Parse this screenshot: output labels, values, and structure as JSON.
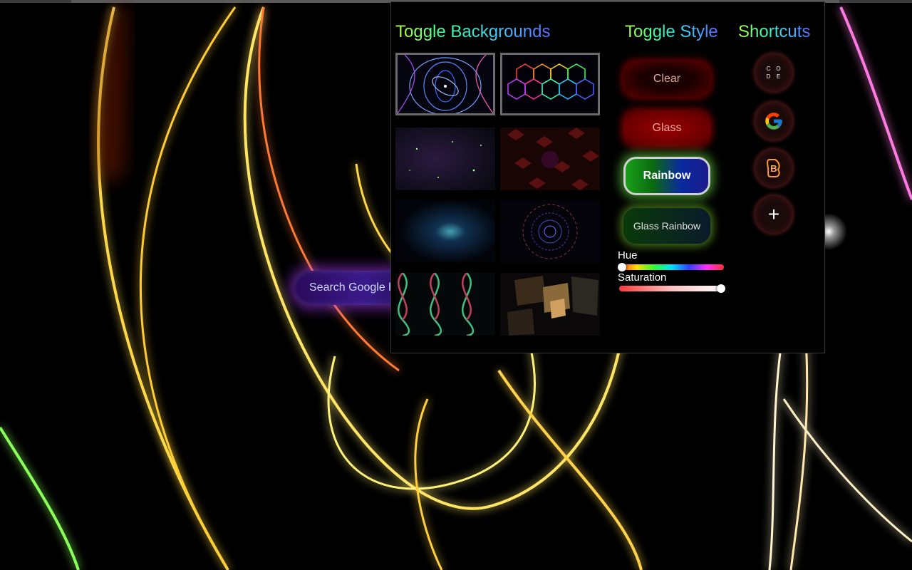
{
  "search": {
    "text": "Search Google h"
  },
  "panel": {
    "backgrounds_title": "Toggle Backgrounds",
    "style_title": "Toggle Style",
    "shortcuts_title": "Shortcuts",
    "backgrounds": [
      {
        "name": "orbit-rings",
        "selected": true
      },
      {
        "name": "neon-hexagons",
        "selected": true
      },
      {
        "name": "starfield",
        "selected": false
      },
      {
        "name": "red-pattern",
        "selected": false
      },
      {
        "name": "blue-nebula",
        "selected": false
      },
      {
        "name": "circle-tunnel",
        "selected": false
      },
      {
        "name": "wave-lattice",
        "selected": false
      },
      {
        "name": "cubes",
        "selected": false
      }
    ],
    "styles": {
      "clear": "Clear",
      "glass": "Glass",
      "rainbow": "Rainbow",
      "glass_rainbow": "Glass Rainbow",
      "selected": "Rainbow"
    },
    "sliders": {
      "hue_label": "Hue",
      "hue_value": 0.0,
      "saturation_label": "Saturation",
      "saturation_value": 1.0
    },
    "shortcuts": [
      {
        "icon": "code-icon",
        "letters": [
          "C",
          "O",
          "D",
          "E"
        ]
      },
      {
        "icon": "google-icon"
      },
      {
        "icon": "bootstrap-icon"
      },
      {
        "icon": "plus-icon",
        "glyph": "+"
      }
    ]
  },
  "colors": {
    "accent": "#ffd93a",
    "panel_bg": "#000000"
  }
}
